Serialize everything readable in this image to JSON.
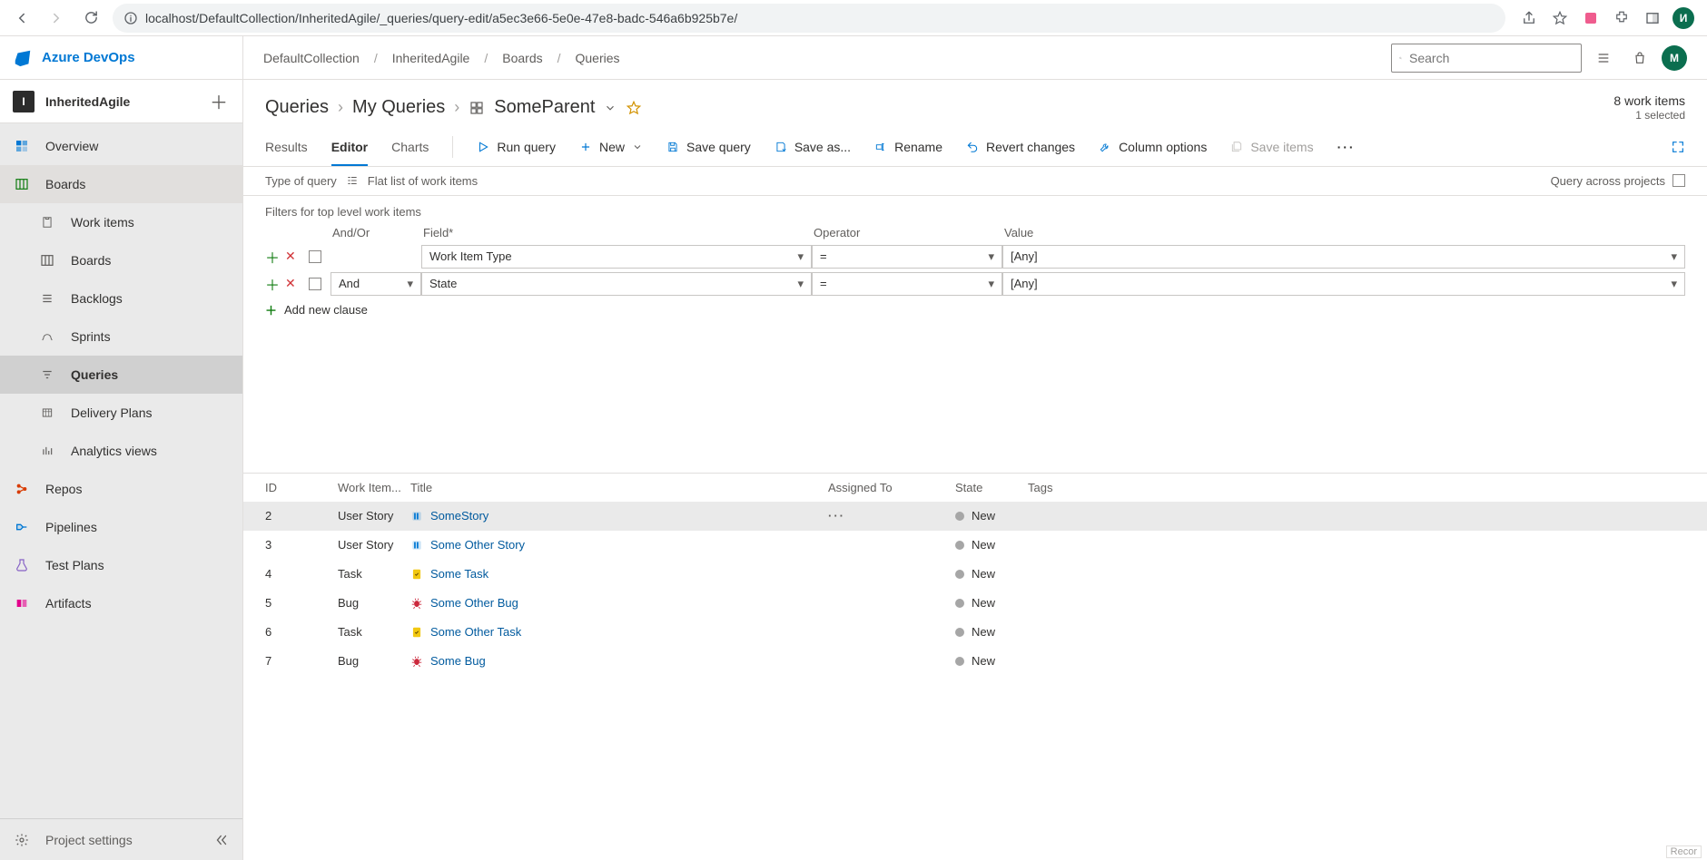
{
  "browser": {
    "url": "localhost/DefaultCollection/InheritedAgile/_queries/query-edit/a5ec3e66-5e0e-47e8-badc-546a6b925b7e/",
    "avatar_initial": "И"
  },
  "brand": "Azure DevOps",
  "project": {
    "badge": "I",
    "name": "InheritedAgile"
  },
  "sidebar": {
    "items": [
      {
        "label": "Overview",
        "color": "c-overview"
      },
      {
        "label": "Boards",
        "color": "c-boards"
      },
      {
        "label": "Work items",
        "sub": true
      },
      {
        "label": "Boards",
        "sub": true
      },
      {
        "label": "Backlogs",
        "sub": true
      },
      {
        "label": "Sprints",
        "sub": true
      },
      {
        "label": "Queries",
        "sub": true,
        "selected": true
      },
      {
        "label": "Delivery Plans",
        "sub": true
      },
      {
        "label": "Analytics views",
        "sub": true
      },
      {
        "label": "Repos",
        "color": "c-repos"
      },
      {
        "label": "Pipelines",
        "color": "c-pipelines"
      },
      {
        "label": "Test Plans",
        "color": "c-test"
      },
      {
        "label": "Artifacts",
        "color": "c-artifacts"
      }
    ],
    "footer": "Project settings"
  },
  "breadcrumb": [
    "DefaultCollection",
    "InheritedAgile",
    "Boards",
    "Queries"
  ],
  "search_placeholder": "Search",
  "page": {
    "crumbs": [
      "Queries",
      "My Queries"
    ],
    "title": "SomeParent",
    "count_text": "8 work items",
    "selected_text": "1 selected"
  },
  "pivots": [
    "Results",
    "Editor",
    "Charts"
  ],
  "toolbar": {
    "run": "Run query",
    "new": "New",
    "save": "Save query",
    "saveas": "Save as...",
    "rename": "Rename",
    "revert": "Revert changes",
    "columns": "Column options",
    "saveitems": "Save items"
  },
  "qtype": {
    "label": "Type of query",
    "value": "Flat list of work items",
    "cross": "Query across projects"
  },
  "filters": {
    "title": "Filters for top level work items",
    "head": {
      "andor": "And/Or",
      "field": "Field*",
      "op": "Operator",
      "val": "Value"
    },
    "rows": [
      {
        "andor": "",
        "field": "Work Item Type",
        "op": "=",
        "val": "[Any]"
      },
      {
        "andor": "And",
        "field": "State",
        "op": "=",
        "val": "[Any]"
      }
    ],
    "add": "Add new clause"
  },
  "grid": {
    "head": {
      "id": "ID",
      "type": "Work Item...",
      "title": "Title",
      "assigned": "Assigned To",
      "state": "State",
      "tags": "Tags"
    },
    "rows": [
      {
        "id": "2",
        "type": "User Story",
        "kind": "story",
        "title": "SomeStory",
        "state": "New",
        "selected": true
      },
      {
        "id": "3",
        "type": "User Story",
        "kind": "story",
        "title": "Some Other Story",
        "state": "New"
      },
      {
        "id": "4",
        "type": "Task",
        "kind": "task",
        "title": "Some Task",
        "state": "New"
      },
      {
        "id": "5",
        "type": "Bug",
        "kind": "bug",
        "title": "Some Other Bug",
        "state": "New"
      },
      {
        "id": "6",
        "type": "Task",
        "kind": "task",
        "title": "Some Other Task",
        "state": "New"
      },
      {
        "id": "7",
        "type": "Bug",
        "kind": "bug",
        "title": "Some Bug",
        "state": "New"
      }
    ]
  },
  "status_corner": "Recor"
}
